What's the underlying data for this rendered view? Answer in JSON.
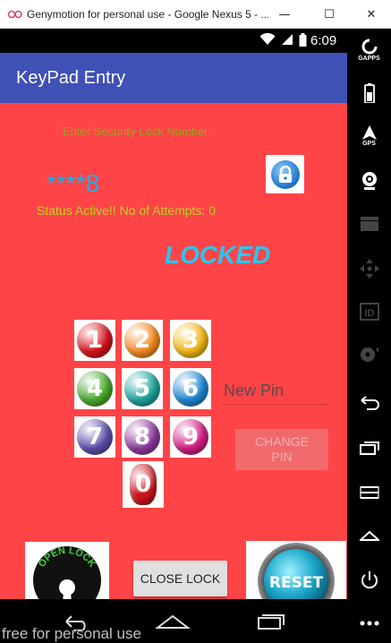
{
  "window": {
    "title": "Genymotion for personal use - Google Nexus 5 - ...",
    "minimize_glyph": "—",
    "maximize_glyph": "☐",
    "close_glyph": "✕"
  },
  "status_bar": {
    "time": "6:09",
    "icons": [
      "wifi-icon",
      "signal-icon",
      "battery-icon"
    ]
  },
  "app": {
    "title": "KeyPad Entry",
    "prompt": "Enter Security Lock Number",
    "masked_entry": "****8",
    "status_text": "Status Active!! No of Attempts: 0",
    "lock_state": "LOCKED",
    "keys": [
      {
        "digit": "1",
        "color": "#d3141b"
      },
      {
        "digit": "2",
        "color": "#f28a20"
      },
      {
        "digit": "3",
        "color": "#f2b614"
      },
      {
        "digit": "4",
        "color": "#4aa82b"
      },
      {
        "digit": "5",
        "color": "#1ca49b"
      },
      {
        "digit": "6",
        "color": "#1f86d5"
      },
      {
        "digit": "7",
        "color": "#5a4fa8"
      },
      {
        "digit": "8",
        "color": "#8c3a9e"
      },
      {
        "digit": "9",
        "color": "#d21c83"
      },
      {
        "digit": "0",
        "color": "#c8141c"
      }
    ],
    "new_pin_placeholder": "New Pin",
    "change_pin_label": "CHANGE PIN",
    "open_lock_label": "OPEN LOCK",
    "close_lock_label": "CLOSE LOCK",
    "reset_label": "RESET"
  },
  "genymotion_toolbar": {
    "items": [
      {
        "icon": "gapps-icon",
        "label": "GAPPS"
      },
      {
        "icon": "battery-icon",
        "label": ""
      },
      {
        "icon": "gps-icon",
        "label": "GPS"
      },
      {
        "icon": "webcam-icon",
        "label": ""
      },
      {
        "icon": "capture-icon",
        "label": ""
      },
      {
        "icon": "dpad-icon",
        "label": ""
      },
      {
        "icon": "id-icon",
        "label": ""
      },
      {
        "icon": "sound-icon",
        "label": ""
      },
      {
        "icon": "back-icon",
        "label": ""
      },
      {
        "icon": "recent-apps-icon",
        "label": ""
      },
      {
        "icon": "menu-icon",
        "label": ""
      },
      {
        "icon": "home-icon",
        "label": ""
      },
      {
        "icon": "power-icon",
        "label": ""
      },
      {
        "icon": "more-icon",
        "label": ""
      }
    ]
  },
  "watermark": "free for personal use",
  "colors": {
    "app_bar": "#3f51b5",
    "background": "#ff4447",
    "prompt_text": "#9aa31c",
    "masked_text": "#2aa8e0",
    "status_text": "#b8d61e",
    "locked_text": "#29c6ef"
  }
}
